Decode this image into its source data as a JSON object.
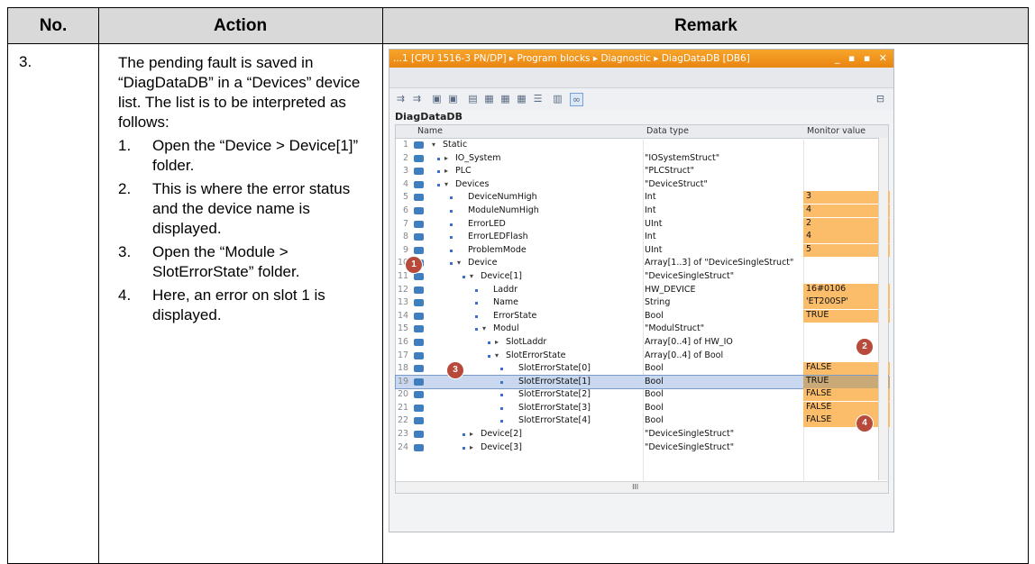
{
  "table": {
    "headers": [
      "No.",
      "Action",
      "Remark"
    ],
    "step_no": "3.",
    "action_intro": "The pending fault is saved in “DiagDataDB” in a “Devices” device list. The list is to be interpreted as follows:",
    "steps": [
      {
        "n": "1.",
        "text": "Open the “Device > Device[1]” folder."
      },
      {
        "n": "2.",
        "text": "This is where the error status and the device name is displayed."
      },
      {
        "n": "3.",
        "text": "Open the “Module > SlotErrorState” folder."
      },
      {
        "n": "4.",
        "text": "Here, an error on slot 1 is displayed."
      }
    ]
  },
  "screenshot": {
    "title": "...1 [CPU 1516-3 PN/DP] ▸ Program blocks ▸ Diagnostic ▸ DiagDataDB [DB6]",
    "window_controls": "_ ▪ ▪ ✕",
    "db_name": "DiagDataDB",
    "columns": {
      "name": "Name",
      "data_type": "Data type",
      "monitor_value": "Monitor value"
    },
    "rows": [
      {
        "num": "1",
        "name": "Static",
        "dtype": "",
        "mon": ""
      },
      {
        "num": "2",
        "name": "IO_System",
        "dtype": "\"IOSystemStruct\"",
        "mon": ""
      },
      {
        "num": "3",
        "name": "PLC",
        "dtype": "\"PLCStruct\"",
        "mon": ""
      },
      {
        "num": "4",
        "name": "Devices",
        "dtype": "\"DeviceStruct\"",
        "mon": ""
      },
      {
        "num": "5",
        "name": "DeviceNumHigh",
        "dtype": "Int",
        "mon": "3"
      },
      {
        "num": "6",
        "name": "ModuleNumHigh",
        "dtype": "Int",
        "mon": "4"
      },
      {
        "num": "7",
        "name": "ErrorLED",
        "dtype": "UInt",
        "mon": "2"
      },
      {
        "num": "8",
        "name": "ErrorLEDFlash",
        "dtype": "Int",
        "mon": "4"
      },
      {
        "num": "9",
        "name": "ProblemMode",
        "dtype": "UInt",
        "mon": "5"
      },
      {
        "num": "10",
        "name": "Device",
        "dtype": "Array[1..3] of \"DeviceSingleStruct\"",
        "mon": ""
      },
      {
        "num": "11",
        "name": "Device[1]",
        "dtype": "\"DeviceSingleStruct\"",
        "mon": ""
      },
      {
        "num": "12",
        "name": "Laddr",
        "dtype": "HW_DEVICE",
        "mon": "16#0106"
      },
      {
        "num": "13",
        "name": "Name",
        "dtype": "String",
        "mon": "'ET200SP'"
      },
      {
        "num": "14",
        "name": "ErrorState",
        "dtype": "Bool",
        "mon": "TRUE"
      },
      {
        "num": "15",
        "name": "Modul",
        "dtype": "\"ModulStruct\"",
        "mon": ""
      },
      {
        "num": "16",
        "name": "SlotLaddr",
        "dtype": "Array[0..4] of HW_IO",
        "mon": ""
      },
      {
        "num": "17",
        "name": "SlotErrorState",
        "dtype": "Array[0..4] of Bool",
        "mon": ""
      },
      {
        "num": "18",
        "name": "SlotErrorState[0]",
        "dtype": "Bool",
        "mon": "FALSE"
      },
      {
        "num": "19",
        "name": "SlotErrorState[1]",
        "dtype": "Bool",
        "mon": "TRUE"
      },
      {
        "num": "20",
        "name": "SlotErrorState[2]",
        "dtype": "Bool",
        "mon": "FALSE"
      },
      {
        "num": "21",
        "name": "SlotErrorState[3]",
        "dtype": "Bool",
        "mon": "FALSE"
      },
      {
        "num": "22",
        "name": "SlotErrorState[4]",
        "dtype": "Bool",
        "mon": "FALSE"
      },
      {
        "num": "23",
        "name": "Device[2]",
        "dtype": "\"DeviceSingleStruct\"",
        "mon": ""
      },
      {
        "num": "24",
        "name": "Device[3]",
        "dtype": "\"DeviceSingleStruct\"",
        "mon": ""
      }
    ],
    "badges": [
      "1",
      "2",
      "3",
      "4"
    ],
    "hscroll_thumb": "III"
  }
}
